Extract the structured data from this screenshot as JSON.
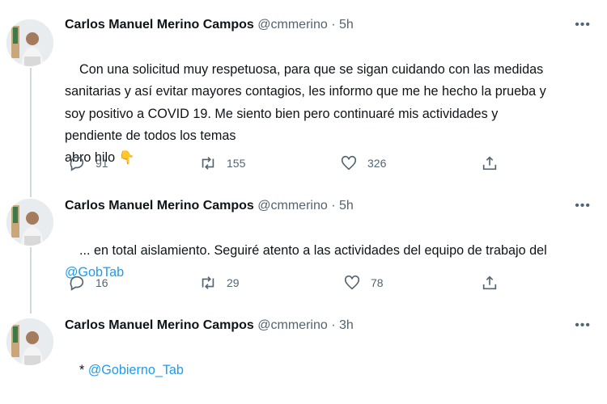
{
  "tweets": [
    {
      "name": "Carlos Manuel Merino Campos",
      "handle": "@cmmerino",
      "separator": "·",
      "time": "5h",
      "text": "Con una solicitud muy respetuosa, para que se sigan cuidando con las medidas sanitarias y así evitar mayores contagios, les informo que me he hecho la prueba y soy positivo a COVID 19. Me siento bien pero continuaré mis actividades y pendiente de todos los temas",
      "text_line2": "abro hilo",
      "emoji": "👇",
      "replies": "91",
      "retweets": "155",
      "likes": "326"
    },
    {
      "name": "Carlos Manuel Merino Campos",
      "handle": "@cmmerino",
      "separator": "·",
      "time": "5h",
      "text": "... en total aislamiento. Seguiré atento a las actividades del equipo de trabajo del ",
      "mention": "@GobTab",
      "replies": "16",
      "retweets": "29",
      "likes": "78"
    },
    {
      "name": "Carlos Manuel Merino Campos",
      "handle": "@cmmerino",
      "separator": "·",
      "time": "3h",
      "prefix": "* ",
      "mention": "@Gobierno_Tab"
    }
  ],
  "icons": {
    "more": "more-horizontal-icon",
    "reply": "reply-icon",
    "retweet": "retweet-icon",
    "like": "heart-icon",
    "share": "share-icon"
  },
  "colors": {
    "link": "#1d9bf0",
    "secondary": "#536471",
    "thread_line": "#cfd9de"
  }
}
